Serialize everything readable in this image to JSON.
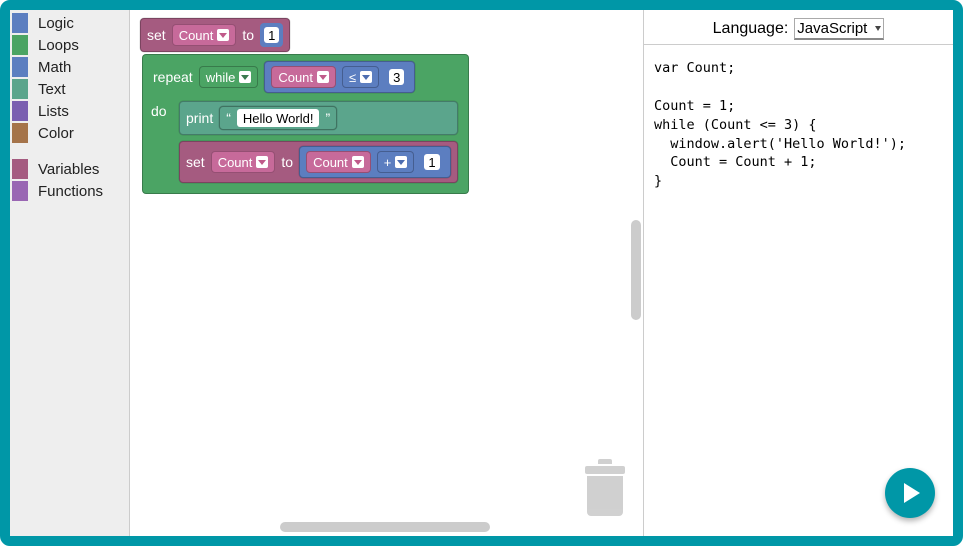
{
  "toolbox": {
    "categories": [
      {
        "label": "Logic",
        "color": "#5c7ec0"
      },
      {
        "label": "Loops",
        "color": "#4ba464"
      },
      {
        "label": "Math",
        "color": "#5c7ec0"
      },
      {
        "label": "Text",
        "color": "#5ba58c"
      },
      {
        "label": "Lists",
        "color": "#7a5fb0"
      },
      {
        "label": "Color",
        "color": "#a5744a"
      }
    ],
    "extra": [
      {
        "label": "Variables",
        "color": "#a55b80"
      },
      {
        "label": "Functions",
        "color": "#9966b3"
      }
    ]
  },
  "blocks": {
    "set1": {
      "label_set": "set",
      "var": "Count",
      "label_to": "to",
      "value": "1"
    },
    "repeat": {
      "label_repeat": "repeat",
      "mode": "while",
      "label_do": "do"
    },
    "cond": {
      "var": "Count",
      "op": "≤",
      "value": "3"
    },
    "print": {
      "label": "print",
      "quote_l": "“",
      "text": "Hello World!",
      "quote_r": "”"
    },
    "set2": {
      "label_set": "set",
      "var": "Count",
      "label_to": "to"
    },
    "add": {
      "var": "Count",
      "op": "+",
      "value": "1"
    }
  },
  "language": {
    "label": "Language:",
    "selected": "JavaScript"
  },
  "code": "var Count;\n\nCount = 1;\nwhile (Count <= 3) {\n  window.alert('Hello World!');\n  Count = Count + 1;\n}"
}
